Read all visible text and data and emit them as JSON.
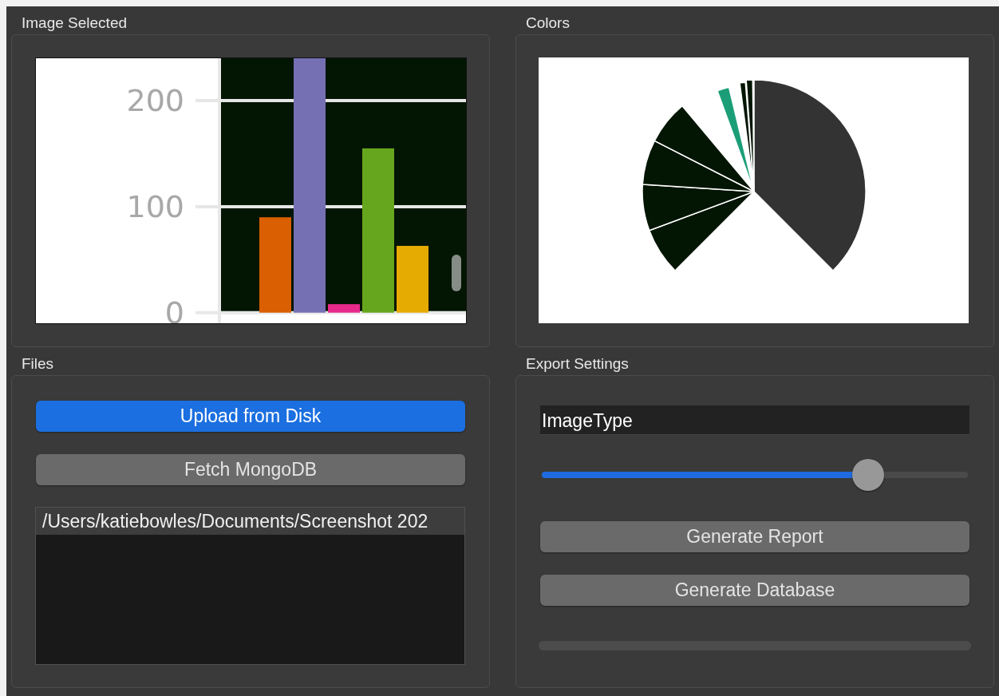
{
  "panels": [
    {
      "title": "Image Selected",
      "kind": "image",
      "chart_data": {
        "type": "bar",
        "ylim": [
          -10,
          240
        ],
        "yticks": [
          0,
          100,
          200
        ],
        "stacked": true,
        "series": [
          {
            "color": "#d95f02",
            "values": [
              90,
              null,
              null,
              null,
              null
            ]
          },
          {
            "color": "#7570b3",
            "values": [
              null,
              240,
              null,
              null,
              null
            ]
          },
          {
            "color": "#e7298a",
            "values": [
              null,
              null,
              8,
              null,
              null
            ]
          },
          {
            "color": "#66a61e",
            "values": [
              null,
              null,
              null,
              155,
              null
            ]
          },
          {
            "color": "#e6ab02",
            "values": [
              null,
              null,
              null,
              null,
              63
            ]
          }
        ]
      }
    },
    {
      "title": "Colors",
      "kind": "pie"
    },
    {
      "title": "Files",
      "kind": "files",
      "buttons": [
        {
          "label": "Upload from Disk",
          "primary": true
        },
        {
          "label": "Fetch MongoDB",
          "primary": false
        }
      ],
      "files": [
        {
          "path": "/Users/katiebowles/Documents/Screenshot 202",
          "selected": true
        }
      ]
    },
    {
      "title": "Export Settings",
      "kind": "export",
      "field": {
        "value": "ImageType"
      },
      "slider": {
        "level": 0.766
      },
      "buttons": [
        {
          "label": "Generate Report"
        },
        {
          "label": "Generate Database"
        }
      ],
      "progress": {
        "level": 0
      }
    }
  ]
}
